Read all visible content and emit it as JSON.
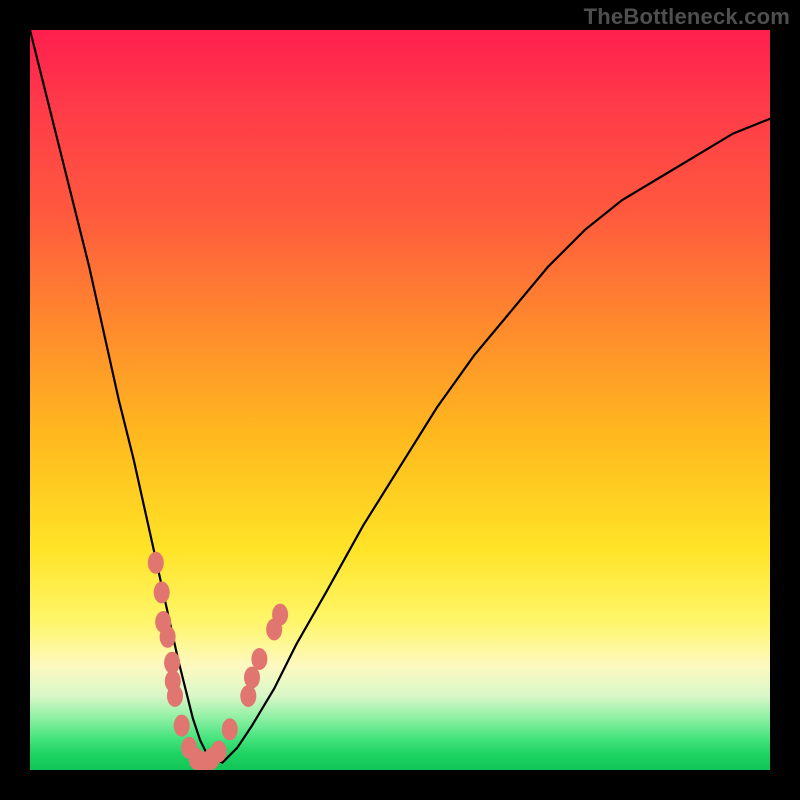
{
  "watermark": "TheBottleneck.com",
  "colors": {
    "frame": "#000000",
    "watermark_text": "#4f4f4f",
    "dot_fill": "#e0766f",
    "curve_stroke": "#000000",
    "gradient_top": "#ff1f4e",
    "gradient_bottom": "#11c558"
  },
  "chart_data": {
    "type": "line",
    "title": "",
    "xlabel": "",
    "ylabel": "",
    "xlim": [
      0,
      100
    ],
    "ylim": [
      0,
      100
    ],
    "note": "Axes are unlabeled in the original image. x is plotted left→right across the inner square, y is plotted with 0 at the bottom (green) and 100 at the top (red). Values are read off the curve position relative to the inner square.",
    "series": [
      {
        "name": "bottleneck-curve",
        "x": [
          0,
          2,
          4,
          6,
          8,
          10,
          12,
          14,
          16,
          18,
          20,
          21,
          22,
          23,
          24,
          26,
          28,
          30,
          33,
          36,
          40,
          45,
          50,
          55,
          60,
          65,
          70,
          75,
          80,
          85,
          90,
          95,
          100
        ],
        "y": [
          100,
          92,
          84,
          76,
          68,
          59,
          50,
          42,
          33,
          24,
          15,
          11,
          7,
          4,
          2,
          1,
          3,
          6,
          11,
          17,
          24,
          33,
          41,
          49,
          56,
          62,
          68,
          73,
          77,
          80,
          83,
          86,
          88
        ]
      }
    ],
    "marker_points": {
      "name": "highlighted-dots",
      "note": "Salmon-colored dots clustered near the curve minimum.",
      "points": [
        {
          "x": 17.0,
          "y": 28.0
        },
        {
          "x": 17.8,
          "y": 24.0
        },
        {
          "x": 18.0,
          "y": 20.0
        },
        {
          "x": 18.6,
          "y": 18.0
        },
        {
          "x": 19.2,
          "y": 14.5
        },
        {
          "x": 19.3,
          "y": 12.0
        },
        {
          "x": 19.6,
          "y": 10.0
        },
        {
          "x": 20.5,
          "y": 6.0
        },
        {
          "x": 21.5,
          "y": 3.0
        },
        {
          "x": 22.5,
          "y": 1.5
        },
        {
          "x": 23.5,
          "y": 1.0
        },
        {
          "x": 24.5,
          "y": 1.5
        },
        {
          "x": 25.5,
          "y": 2.5
        },
        {
          "x": 27.0,
          "y": 5.5
        },
        {
          "x": 29.5,
          "y": 10.0
        },
        {
          "x": 30.0,
          "y": 12.5
        },
        {
          "x": 31.0,
          "y": 15.0
        },
        {
          "x": 33.0,
          "y": 19.0
        },
        {
          "x": 33.8,
          "y": 21.0
        }
      ]
    }
  }
}
